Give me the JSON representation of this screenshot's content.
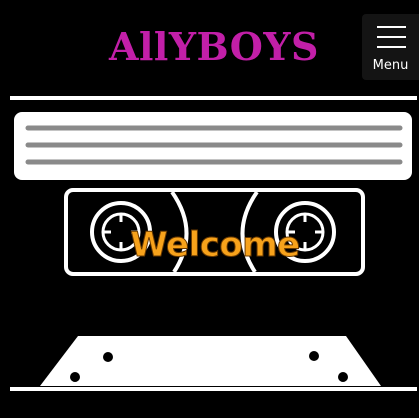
{
  "header": {
    "brand": "AllYBOYS",
    "menu_label": "Menu",
    "menu_icon": "hamburger-icon"
  },
  "hero": {
    "welcome_text": "Welcome"
  },
  "colors": {
    "background": "#000000",
    "brand": "#c21fa8",
    "accent": "#f7a21b",
    "foreground": "#ffffff"
  }
}
